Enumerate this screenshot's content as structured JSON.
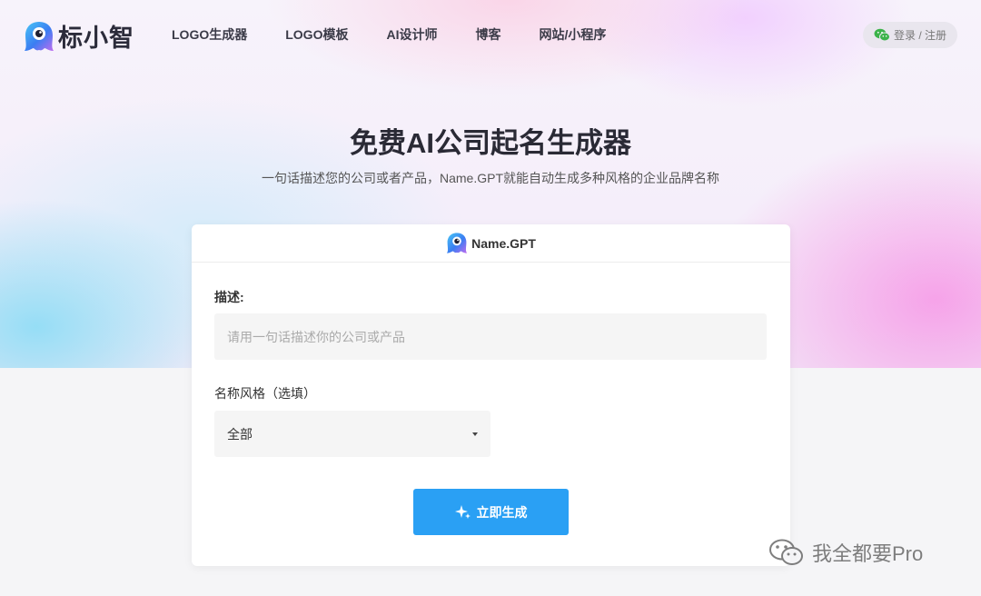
{
  "brand": {
    "name": "标小智"
  },
  "nav": {
    "items": [
      "LOGO生成器",
      "LOGO模板",
      "AI设计师",
      "博客",
      "网站/小程序"
    ]
  },
  "login": {
    "label": "登录 / 注册",
    "icon": "wechat-icon"
  },
  "hero": {
    "title": "免费AI公司起名生成器",
    "subtitle": "一句话描述您的公司或者产品，Name.GPT就能自动生成多种风格的企业品牌名称"
  },
  "card": {
    "header": "Name.GPT",
    "desc_label": "描述:",
    "desc_placeholder": "请用一句话描述你的公司或产品",
    "desc_value": "",
    "style_label": "名称风格（选填）",
    "style_value": "全部",
    "generate_label": "立即生成"
  },
  "watermark": {
    "text": "我全都要Pro"
  },
  "colors": {
    "accent": "#2aa0f4",
    "brand_blue": "#2f7cf6"
  }
}
